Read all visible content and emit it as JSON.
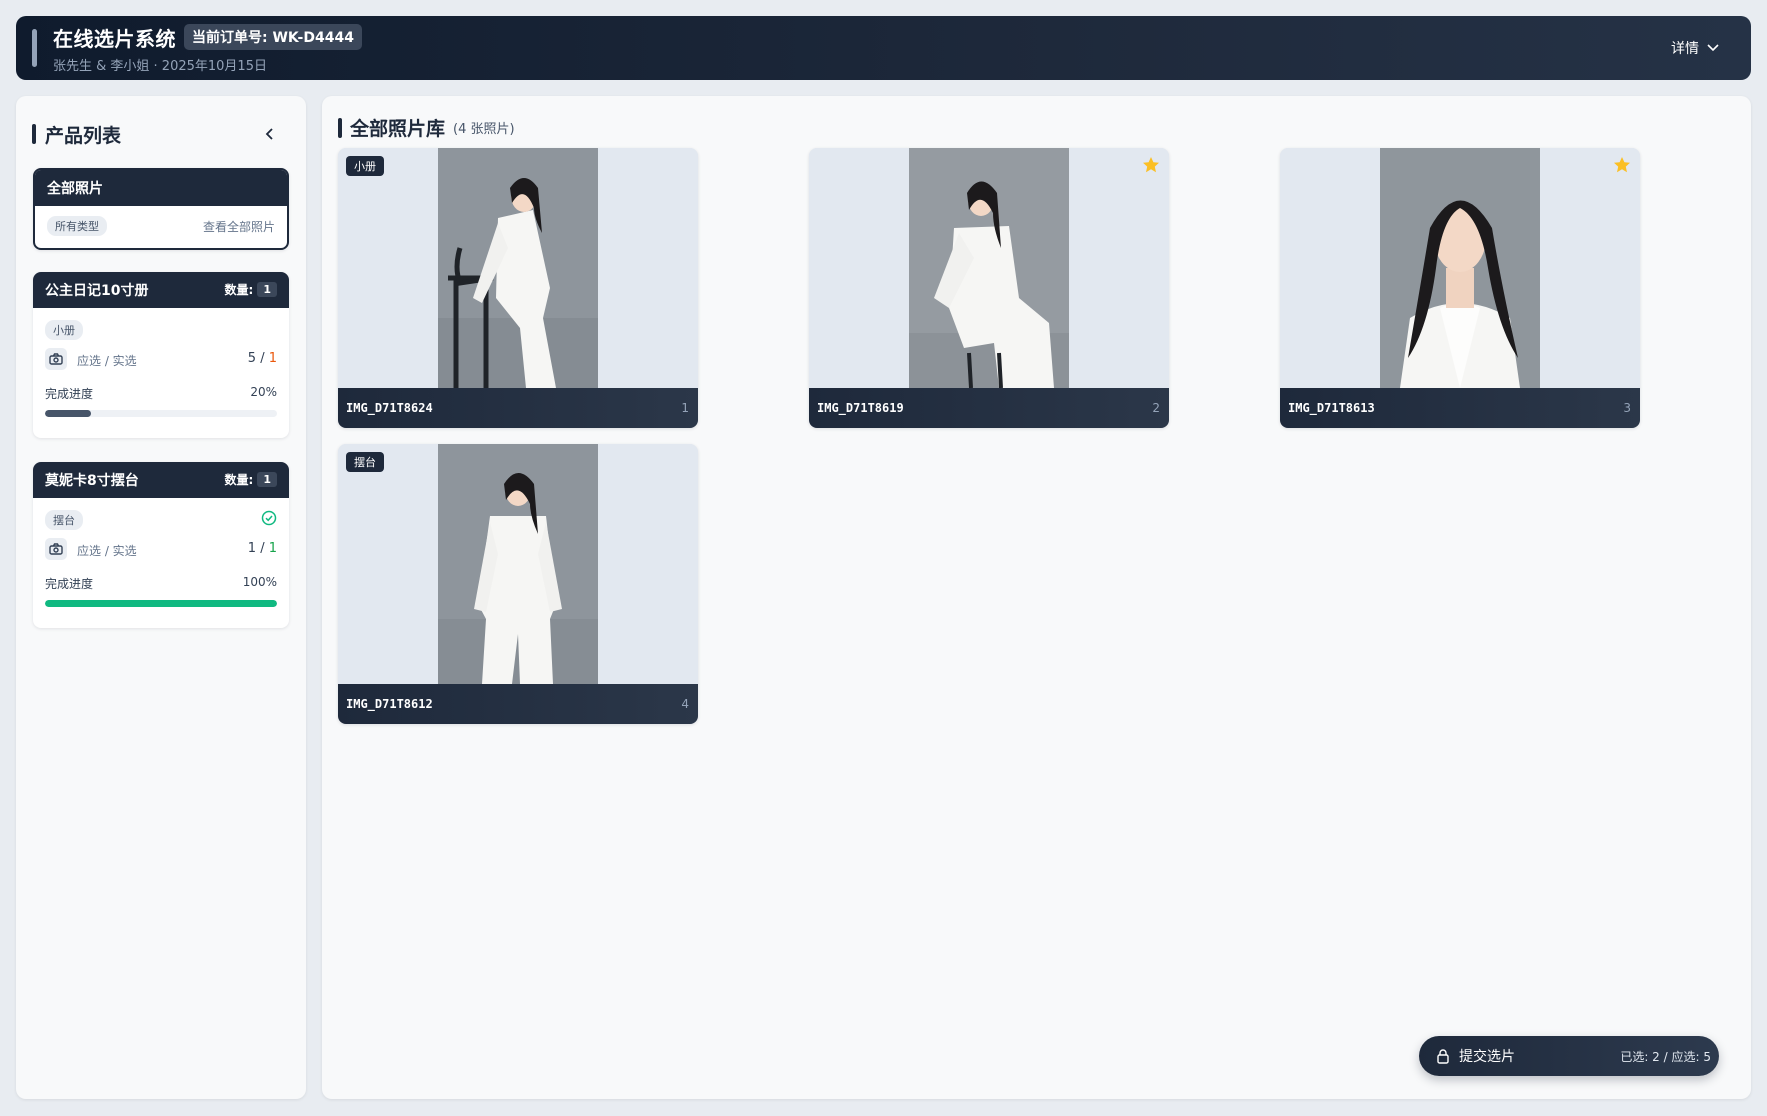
{
  "header": {
    "title": "在线选片系统",
    "order_badge": "当前订单号: WK-D4444",
    "subtitle": "张先生 & 李小姐 · 2025年10月15日",
    "details_label": "详情"
  },
  "sidebar": {
    "title": "产品列表",
    "all_card": {
      "title": "全部照片",
      "tag": "所有类型",
      "view_all": "查看全部照片"
    },
    "products": [
      {
        "name": "公主日记10寸册",
        "qty_label": "数量:",
        "qty": "1",
        "tag": "小册",
        "select_label": "应选 / 实选",
        "required": "5",
        "sep": " / ",
        "selected": "1",
        "progress_label": "完成进度",
        "progress_text": "20%",
        "progress": 0.2,
        "complete": false
      },
      {
        "name": "莫妮卡8寸摆台",
        "qty_label": "数量:",
        "qty": "1",
        "tag": "摆台",
        "select_label": "应选 / 实选",
        "required": "1",
        "sep": " / ",
        "selected": "1",
        "progress_label": "完成进度",
        "progress_text": "100%",
        "progress": 1.0,
        "complete": true
      }
    ]
  },
  "gallery": {
    "title": "全部照片库",
    "count_label": "(4 张照片)",
    "photos": [
      {
        "name": "IMG_D71T8624",
        "index": "1",
        "type_badge": "小册",
        "starred": false,
        "pose": "stool"
      },
      {
        "name": "IMG_D71T8619",
        "index": "2",
        "type_badge": "",
        "starred": true,
        "pose": "seated"
      },
      {
        "name": "IMG_D71T8613",
        "index": "3",
        "type_badge": "",
        "starred": true,
        "pose": "portrait"
      },
      {
        "name": "IMG_D71T8612",
        "index": "4",
        "type_badge": "摆台",
        "starred": false,
        "pose": "standing"
      }
    ]
  },
  "submit": {
    "label": "提交选片",
    "status": "已选: 2 / 应选: 5"
  },
  "colors": {
    "accent_dark": "#1e293b",
    "progress_partial": "#475569",
    "progress_complete": "#10b981",
    "star": "#fbbf24",
    "selected_orange": "#ea580c"
  }
}
